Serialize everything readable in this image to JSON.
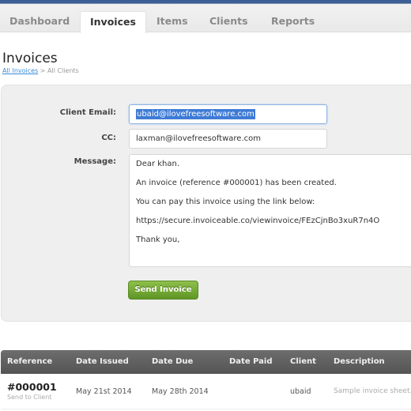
{
  "nav": {
    "tabs": [
      {
        "label": "Dashboard",
        "active": false
      },
      {
        "label": "Invoices",
        "active": true
      },
      {
        "label": "Items",
        "active": false
      },
      {
        "label": "Clients",
        "active": false
      },
      {
        "label": "Reports",
        "active": false
      }
    ]
  },
  "page": {
    "title": "Invoices",
    "breadcrumb": {
      "link": "All Invoices",
      "separator": ">",
      "current": "All Clients"
    }
  },
  "send_form": {
    "client_email_label": "Client Email:",
    "client_email_value": "ubaid@ilovefreesoftware.com",
    "cc_label": "CC:",
    "cc_value": "laxman@ilovefreesoftware.com",
    "message_label": "Message:",
    "message_lines": [
      "Dear khan.",
      "An invoice (reference #000001) has been created.",
      "You can pay this invoice using the link below:",
      "https://secure.invoiceable.co/viewinvoice/FEzCjnBo3xuR7n4O",
      "Thank you,"
    ],
    "send_button_label": "Send Invoice"
  },
  "invoice_table": {
    "columns": [
      "Reference",
      "Date Issued",
      "Date Due",
      "Date Paid",
      "Client",
      "Description"
    ],
    "rows": [
      {
        "reference": "#000001",
        "action": "Send to Client",
        "date_issued": "May 21st 2014",
        "date_due": "May 28th 2014",
        "date_paid": "",
        "client": "ubaid",
        "description": "Sample invoice sheet. To"
      }
    ]
  }
}
